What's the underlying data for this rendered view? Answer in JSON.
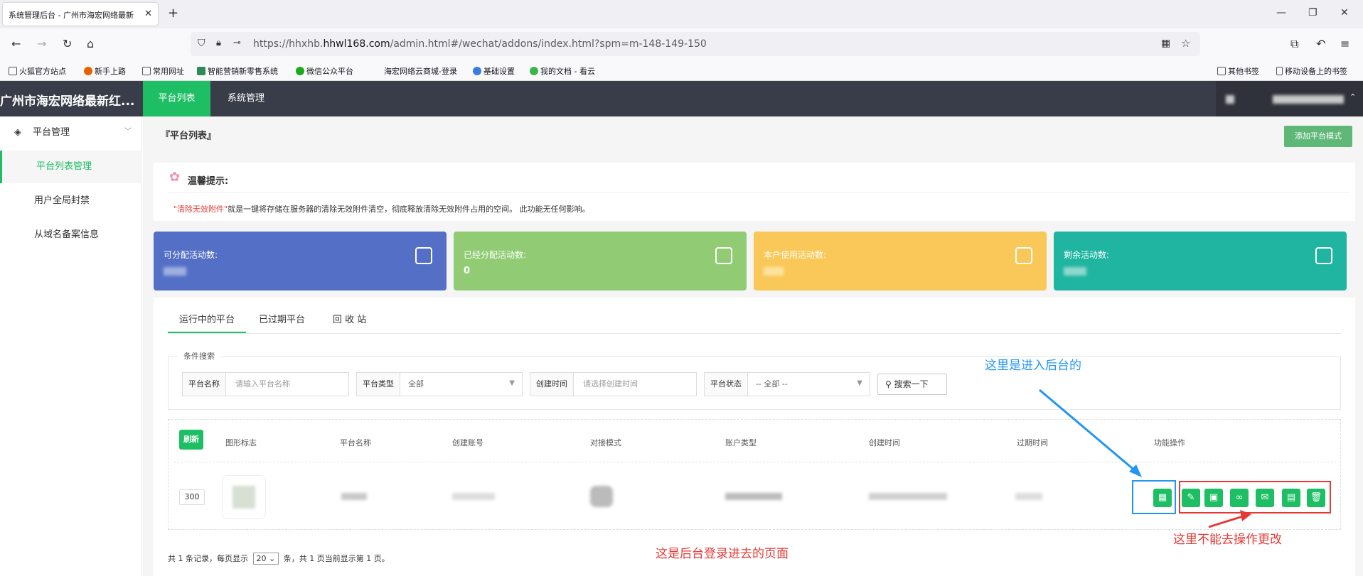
{
  "browser": {
    "tab_title": "系统管理后台 - 广州市海宏网络最新",
    "url_prefix": "https://hhxhb.",
    "url_domain": "hhwl168.com",
    "url_path": "/admin.html#/wechat/addons/index.html?spm=m-148-149-150",
    "bookmarks": [
      "火狐官方站点",
      "新手上路",
      "常用网址",
      "智能营销新零售系统",
      "微信公众平台",
      "海宏网络云商城-登录",
      "基础设置",
      "我的文档 - 看云"
    ],
    "bookmarks_right": [
      "其他书签",
      "移动设备上的书签"
    ]
  },
  "app": {
    "title": "广州市海宏网络最新红...",
    "top_nav": [
      "平台列表",
      "系统管理"
    ]
  },
  "sidebar": {
    "group": "平台管理",
    "items": [
      "平台列表管理",
      "用户全局封禁",
      "从域名备案信息"
    ]
  },
  "page": {
    "breadcrumb": "『平台列表』",
    "add_button": "添加平台模式",
    "tip_title": "温馨提示:",
    "tip_highlight": "\"清除无效附件\"",
    "tip_text": "就是一键将存储在服务器的清除无效附件清空，彻底释放清除无效附件占用的空间。 此功能无任何影响。"
  },
  "stats": [
    {
      "label": "可分配活动数:",
      "value": "",
      "color": "#5470c6"
    },
    {
      "label": "已经分配活动数:",
      "value": "0",
      "color": "#91cc75"
    },
    {
      "label": "本户使用活动数:",
      "value": "",
      "color": "#fac858"
    },
    {
      "label": "剩余活动数:",
      "value": "",
      "color": "#1fb5a0"
    }
  ],
  "tabs": [
    "运行中的平台",
    "已过期平台",
    "回 收 站"
  ],
  "search": {
    "legend": "条件搜索",
    "name_label": "平台名称",
    "name_placeholder": "请输入平台名称",
    "type_label": "平台类型",
    "type_value": "全部",
    "time_label": "创建时间",
    "time_placeholder": "请选择创建时间",
    "status_label": "平台状态",
    "status_value": "-- 全部 --",
    "search_button": "搜索一下"
  },
  "table": {
    "refresh": "刷新",
    "headers": [
      "图形标志",
      "平台名称",
      "创建账号",
      "对接模式",
      "账户类型",
      "创建时间",
      "过期时间",
      "功能操作"
    ],
    "row_id": "300"
  },
  "pagination": {
    "prefix": "共 1 条记录，每页显示",
    "page_size": "20",
    "suffix": "条，共 1 页当前显示第 1 页。"
  },
  "annotations": {
    "backend": "这里是进入后台的",
    "cannot": "这里不能去操作更改",
    "page_note": "这是后台登录进去的页面"
  },
  "colors": {
    "green": "#1ebf64",
    "header": "#393d49",
    "blue_ann": "#2196f3",
    "red_ann": "#e53935"
  }
}
